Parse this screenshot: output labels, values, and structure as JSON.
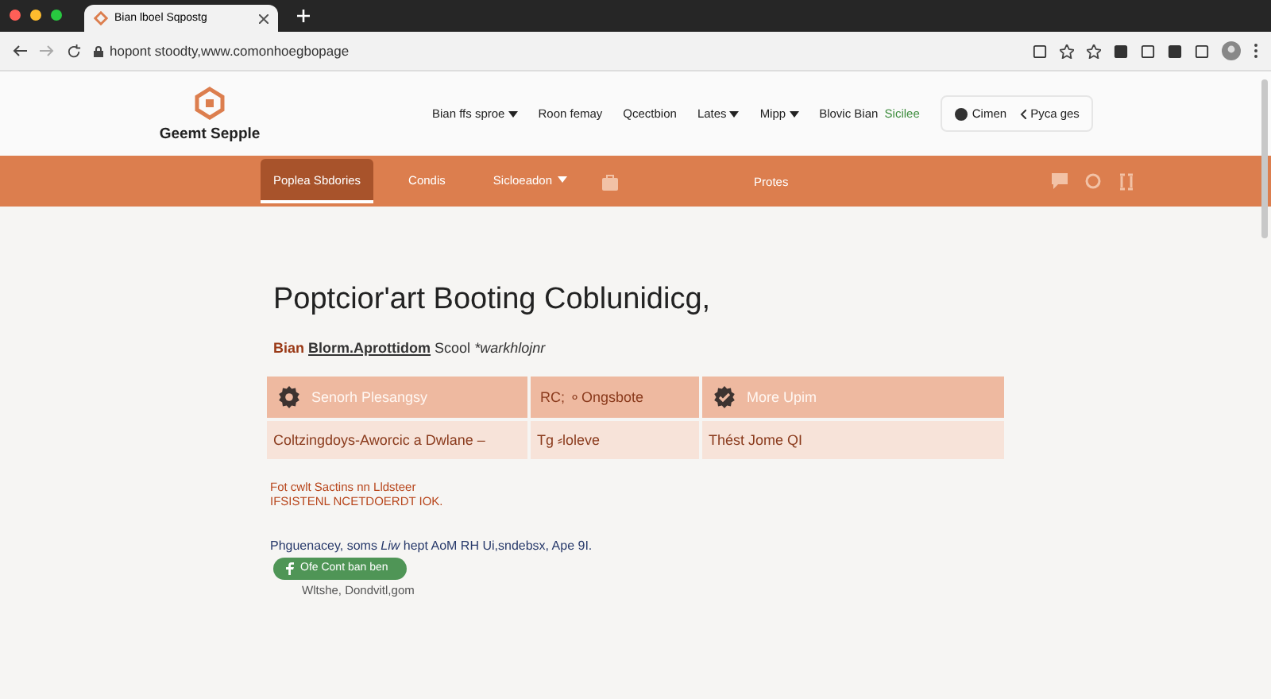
{
  "browser": {
    "tab_title": "Bian lboel Sqpostg",
    "address": "hopont stoodty,www.comonhoegbopage"
  },
  "site": {
    "logo_text": "Geemt Sepple",
    "nav": [
      {
        "label": "Bian ffs sproe",
        "dropdown": true
      },
      {
        "label": "Roon femay",
        "dropdown": false
      },
      {
        "label": "Qcectbion",
        "dropdown": false
      },
      {
        "label": "Lates",
        "dropdown": true
      },
      {
        "label": "Mipp",
        "dropdown": true
      }
    ],
    "nav_highlight": {
      "prefix": "Blovic Bian",
      "accent": "Sicilee"
    },
    "chat_button": "Cimen",
    "pager_label": "Pyca ges"
  },
  "subnav": {
    "items": [
      {
        "label": "Poplea Sbdories",
        "selected": true,
        "dropdown": false
      },
      {
        "label": "Condis",
        "selected": false,
        "dropdown": false
      },
      {
        "label": "Sicloeadon",
        "selected": false,
        "dropdown": true
      }
    ],
    "center_label": "Protes"
  },
  "content": {
    "heading": "Poptcior'art Booting Coblunidicg,",
    "byline": {
      "accent": "Bian",
      "name": "Blorm.Aprottidom",
      "school": "Scool",
      "note": "*warkhlojnr"
    },
    "cards": [
      {
        "kind": "gear",
        "title": "Senorh Plesangsy",
        "body": "Coltzingdoys-Aworcic a Dwlane –"
      },
      {
        "kind": "plain",
        "title": "RC; ⚬Ongsbote",
        "body": "Tg ⸗loleve"
      },
      {
        "kind": "checked",
        "title": "More Upim",
        "body": "Thést Jome QI"
      }
    ],
    "alert": [
      "Fot cwlt Sactins nn Lldsteer",
      "IFSISTENL NCETDOERDT IOK."
    ],
    "paragraph": "Phguenacey, soms *Liw* hept AoM RH Ui,sndebsx, Ape 9I.",
    "pill_button": "Ofe Cont ban ben",
    "website": "Wltshe, Dondvitl,gom"
  }
}
